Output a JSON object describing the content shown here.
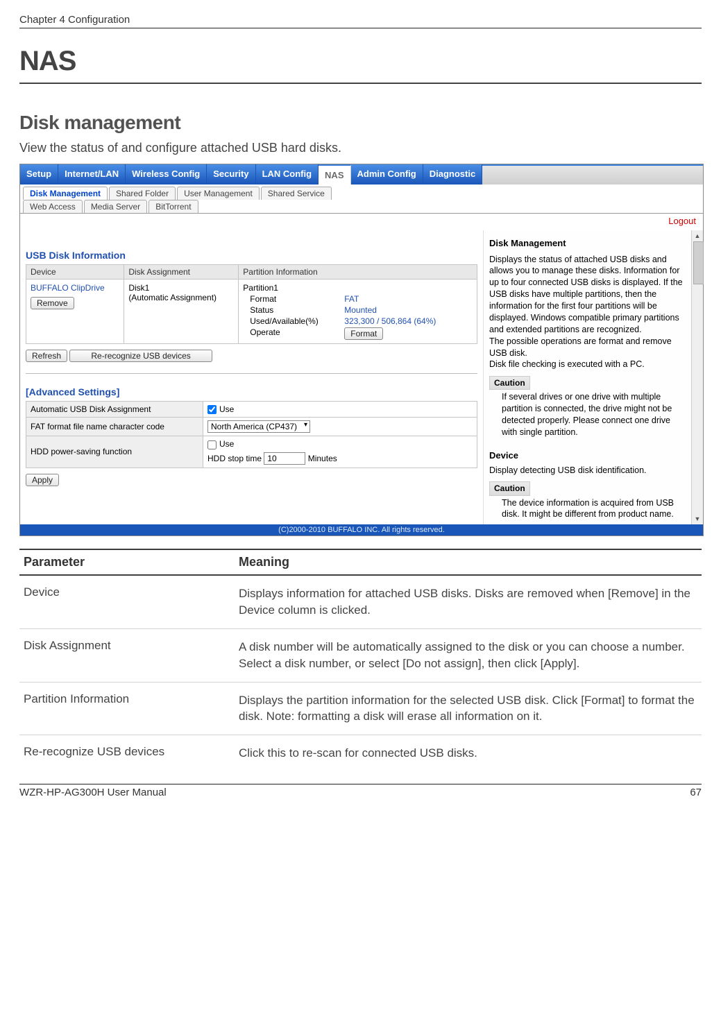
{
  "header": {
    "chapter": "Chapter 4  Configuration"
  },
  "title": "NAS",
  "subtitle": "Disk management",
  "intro": "View the status of and configure attached USB hard disks.",
  "screenshot": {
    "mainTabs": [
      "Setup",
      "Internet/LAN",
      "Wireless Config",
      "Security",
      "LAN Config",
      "NAS",
      "Admin Config",
      "Diagnostic"
    ],
    "activeMainTab": "NAS",
    "subTabsRow1": [
      "Disk Management",
      "Shared Folder",
      "User Management",
      "Shared Service"
    ],
    "subTabsRow2": [
      "Web Access",
      "Media Server",
      "BitTorrent"
    ],
    "activeSubTab": "Disk Management",
    "logout": "Logout",
    "usbTitle": "USB Disk Information",
    "thDevice": "Device",
    "thAssign": "Disk Assignment",
    "thPartition": "Partition Information",
    "deviceName": "BUFFALO ClipDrive",
    "btnRemove": "Remove",
    "assignLine1": "Disk1",
    "assignLine2": "(Automatic Assignment)",
    "partLabel": "Partition1",
    "kFormat": "Format",
    "vFormat": "FAT",
    "kStatus": "Status",
    "vStatus": "Mounted",
    "kUsed": "Used/Available(%)",
    "vUsed": "323,300 / 506,864 (64%)",
    "kOperate": "Operate",
    "btnFormat": "Format",
    "btnRefresh": "Refresh",
    "btnRerec": "Re-recognize USB devices",
    "advancedTitle": "[Advanced Settings]",
    "advAuto": "Automatic USB Disk Assignment",
    "advFat": "FAT format file name character code",
    "advHdd": "HDD power-saving function",
    "useLabel": "Use",
    "codepage": "North America (CP437)",
    "stopLabel": "HDD stop time",
    "stopValue": "10",
    "minutes": "Minutes",
    "btnApply": "Apply",
    "help": {
      "title": "Disk Management",
      "p1": "Displays the status of attached USB disks and allows you to manage these disks. Information for up to four connected USB disks is displayed. If the USB disks have multiple partitions, then the information for the first four partitions will be displayed. Windows compatible primary partitions and extended partitions are recognized.",
      "p2": "The possible operations are format and remove USB disk.",
      "p3": "Disk file checking is executed with a PC.",
      "cautionLabel": "Caution",
      "caution1": "If several drives or one drive with multiple partition is connected, the drive might not be detected properly. Please connect one drive with single partition.",
      "deviceTitle": "Device",
      "devicePara": "Display detecting USB disk identification.",
      "caution2": "The device information is acquired from USB disk. It might be different from product name."
    },
    "copyright": "(C)2000-2010 BUFFALO INC. All rights reserved."
  },
  "paramTable": {
    "hParam": "Parameter",
    "hMeaning": "Meaning",
    "rows": [
      {
        "p": "Device",
        "m": "Displays information for attached USB disks.  Disks are removed when [Remove] in the Device column is clicked."
      },
      {
        "p": "Disk Assignment",
        "m": "A disk number will be automatically assigned to the disk or you can choose a number.  Select a disk number, or select [Do not assign], then click [Apply]."
      },
      {
        "p": "Partition Information",
        "m": "Displays the partition information for the selected USB disk.  Click [Format] to format the disk.  Note:  formatting a disk will erase all information on it."
      },
      {
        "p": "Re-recognize USB devices",
        "m": "Click this to re-scan for connected USB disks."
      }
    ]
  },
  "footer": {
    "manual": "WZR-HP-AG300H User Manual",
    "page": "67"
  }
}
